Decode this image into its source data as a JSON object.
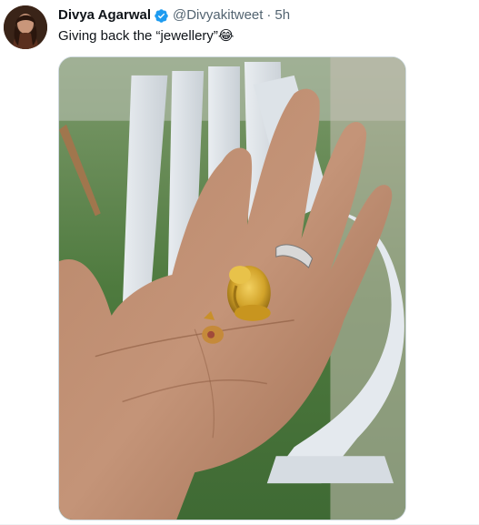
{
  "tweet": {
    "display_name": "Divya Agarwal",
    "handle": "@Divyakitweet",
    "separator": "·",
    "time": "5h",
    "text": "Giving back the “jewellery”😂",
    "verified_icon": "verified-badge-icon",
    "accent_color": "#1d9bf0"
  },
  "media": {
    "kind": "photo"
  }
}
